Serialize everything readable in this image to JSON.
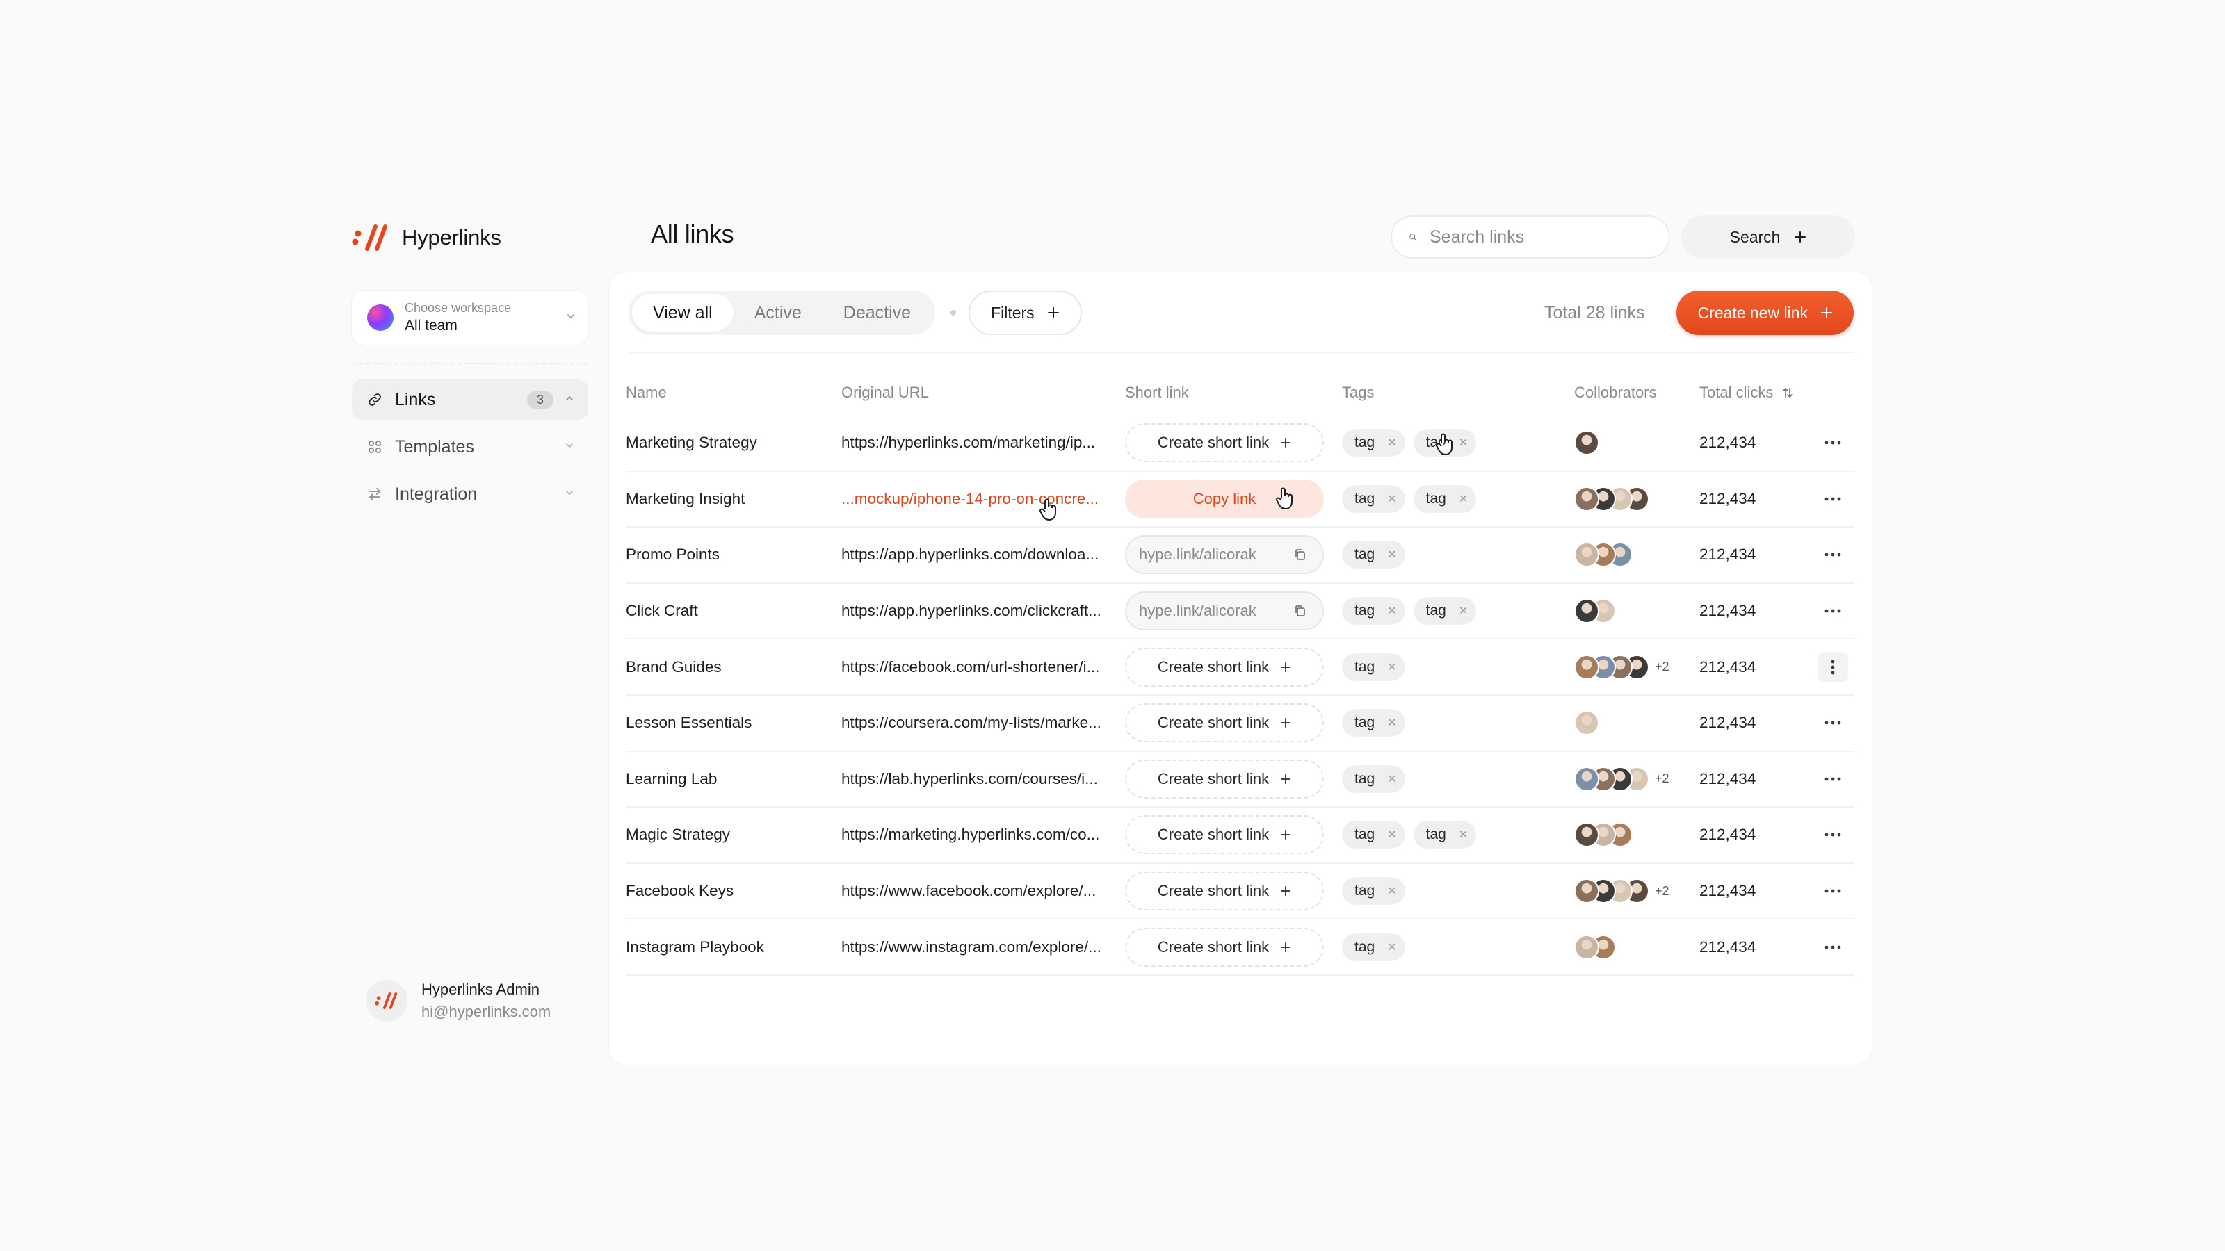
{
  "brand": {
    "name": "Hyperlinks",
    "color": "#e4461d"
  },
  "workspace": {
    "caption": "Choose workspace",
    "name": "All team"
  },
  "nav": [
    {
      "label": "Links",
      "count": "3",
      "icon": "link-icon",
      "active": true
    },
    {
      "label": "Templates",
      "icon": "grid-icon",
      "active": false
    },
    {
      "label": "Integration",
      "icon": "arrows-icon",
      "active": false
    }
  ],
  "admin": {
    "name": "Hyperlinks Admin",
    "email": "hi@hyperlinks.com"
  },
  "header": {
    "title": "All links",
    "search_placeholder": "Search links",
    "search_button": "Search"
  },
  "toolbar": {
    "tabs": [
      "View all",
      "Active",
      "Deactive"
    ],
    "active_tab": "View all",
    "filters_label": "Filters",
    "total_links": "Total 28 links",
    "create_label": "Create new link"
  },
  "table": {
    "columns": [
      "Name",
      "Original URL",
      "Short link",
      "Tags",
      "Collobrators",
      "Total clicks"
    ],
    "rows": [
      {
        "name": "Marketing Strategy",
        "url": "https://hyperlinks.com/marketing/ip...",
        "short": {
          "type": "create",
          "label": "Create short link"
        },
        "tags": [
          "tag",
          "tag"
        ],
        "collab_count": 1,
        "collab_more": "",
        "clicks": "212,434"
      },
      {
        "name": "Marketing Insight",
        "url": "...mockup/iphone-14-pro-on-concre...",
        "url_highlight": true,
        "short": {
          "type": "copy",
          "label": "Copy link"
        },
        "tags": [
          "tag",
          "tag"
        ],
        "collab_count": 4,
        "collab_more": "",
        "clicks": "212,434"
      },
      {
        "name": "Promo Points",
        "url": "https://app.hyperlinks.com/downloa...",
        "short": {
          "type": "field",
          "label": "hype.link/alicorak"
        },
        "tags": [
          "tag"
        ],
        "collab_count": 3,
        "collab_more": "",
        "clicks": "212,434"
      },
      {
        "name": "Click Craft",
        "url": "https://app.hyperlinks.com/clickcraft...",
        "short": {
          "type": "field",
          "label": "hype.link/alicorak"
        },
        "tags": [
          "tag",
          "tag"
        ],
        "collab_count": 2,
        "collab_more": "",
        "clicks": "212,434"
      },
      {
        "name": "Brand Guides",
        "url": "https://facebook.com/url-shortener/i...",
        "short": {
          "type": "create",
          "label": "Create short link"
        },
        "tags": [
          "tag"
        ],
        "collab_count": 4,
        "collab_more": "+2",
        "clicks": "212,434",
        "more_vertical": true
      },
      {
        "name": "Lesson Essentials",
        "url": "https://coursera.com/my-lists/marke...",
        "short": {
          "type": "create",
          "label": "Create short link"
        },
        "tags": [
          "tag"
        ],
        "collab_count": 1,
        "collab_more": "",
        "clicks": "212,434"
      },
      {
        "name": "Learning Lab",
        "url": "https://lab.hyperlinks.com/courses/i...",
        "short": {
          "type": "create",
          "label": "Create short link"
        },
        "tags": [
          "tag"
        ],
        "collab_count": 4,
        "collab_more": "+2",
        "clicks": "212,434"
      },
      {
        "name": "Magic Strategy",
        "url": "https://marketing.hyperlinks.com/co...",
        "short": {
          "type": "create",
          "label": "Create short link"
        },
        "tags": [
          "tag",
          "tag"
        ],
        "collab_count": 3,
        "collab_more": "",
        "clicks": "212,434"
      },
      {
        "name": "Facebook Keys",
        "url": "https://www.facebook.com/explore/...",
        "short": {
          "type": "create",
          "label": "Create short link"
        },
        "tags": [
          "tag"
        ],
        "collab_count": 4,
        "collab_more": "+2",
        "clicks": "212,434"
      },
      {
        "name": "Instagram Playbook",
        "url": "https://www.instagram.com/explore/...",
        "short": {
          "type": "create",
          "label": "Create short link"
        },
        "tags": [
          "tag"
        ],
        "collab_count": 2,
        "collab_more": "",
        "clicks": "212,434"
      }
    ]
  },
  "icons": {
    "search": "search-icon",
    "plus": "plus-icon",
    "close": "close-icon",
    "copy": "copy-icon",
    "more": "more-horizontal-icon",
    "sort": "sort-icon",
    "chevron": "chevron-down-icon"
  }
}
